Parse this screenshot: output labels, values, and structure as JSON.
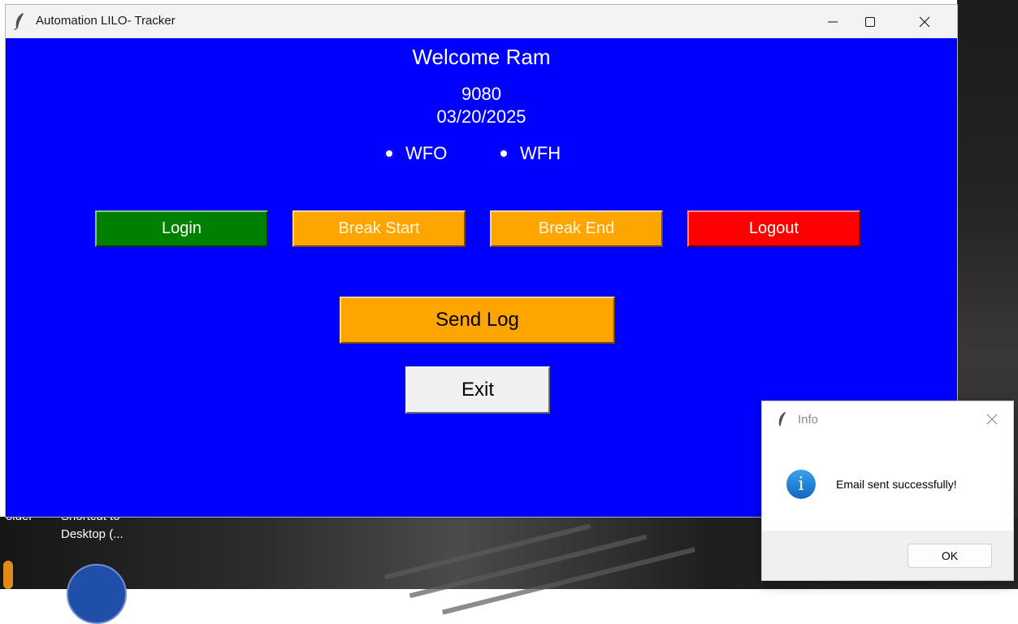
{
  "window": {
    "title": "Automation LILO- Tracker",
    "icon": "feather-icon",
    "controls": [
      "minimize-icon",
      "maximize-icon",
      "close-icon"
    ]
  },
  "header": {
    "welcome": "Welcome Ram",
    "employee_id": "9080",
    "date": "03/20/2025"
  },
  "work_mode": {
    "options": [
      {
        "label": "WFO"
      },
      {
        "label": "WFH"
      }
    ]
  },
  "actions": {
    "login": "Login",
    "break_start": "Break Start",
    "break_end": "Break End",
    "logout": "Logout",
    "send_log": "Send Log",
    "exit": "Exit"
  },
  "colors": {
    "window_background": "#0000ff",
    "login": "#008000",
    "break": "#ffa500",
    "logout": "#ff0000",
    "exit": "#f0f0f0"
  },
  "desktop": {
    "partial_label_1": "older",
    "partial_label_2": "Shortcut to",
    "shortcut_label": "Desktop (..."
  },
  "dialog": {
    "title": "Info",
    "message": "Email sent successfully!",
    "ok_label": "OK",
    "icon": "info-icon"
  }
}
